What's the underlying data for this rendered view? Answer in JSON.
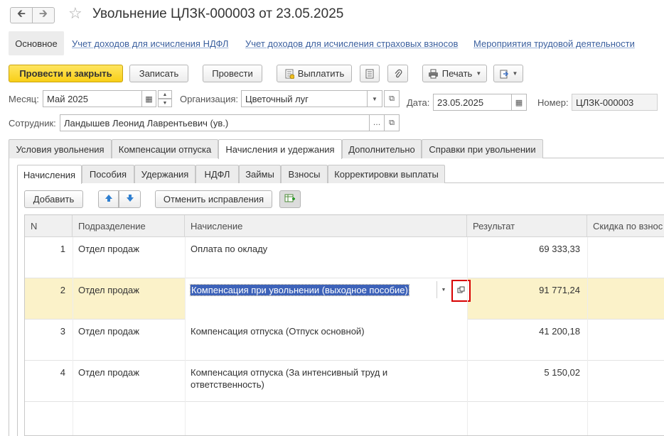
{
  "window": {
    "title": "Увольнение ЦЛЗК-000003 от 23.05.2025"
  },
  "section_tabs": {
    "main": "Основное",
    "links": [
      "Учет доходов для исчисления НДФЛ",
      "Учет доходов для исчисления страховых взносов",
      "Мероприятия трудовой деятельности"
    ]
  },
  "toolbar": {
    "post_close": "Провести и закрыть",
    "save": "Записать",
    "post": "Провести",
    "pay": "Выплатить",
    "print": "Печать"
  },
  "fields": {
    "month_label": "Месяц:",
    "month_value": "Май 2025",
    "org_label": "Организация:",
    "org_value": "Цветочный луг",
    "date_label": "Дата:",
    "date_value": "23.05.2025",
    "number_label": "Номер:",
    "number_value": "ЦЛЗК-000003",
    "employee_label": "Сотрудник:",
    "employee_value": "Ландышев Леонид Лаврентьевич (ув.)"
  },
  "tabs_main": [
    "Условия увольнения",
    "Компенсации отпуска",
    "Начисления и удержания",
    "Дополнительно",
    "Справки при увольнении"
  ],
  "tabs_sub": [
    "Начисления",
    "Пособия",
    "Удержания",
    "НДФЛ",
    "Займы",
    "Взносы",
    "Корректировки выплаты"
  ],
  "grid_toolbar": {
    "add": "Добавить",
    "cancel_fixes": "Отменить исправления"
  },
  "table": {
    "columns": [
      "N",
      "Подразделение",
      "Начисление",
      "Результат",
      "Скидка по взнос"
    ],
    "rows": [
      {
        "n": "1",
        "dept": "Отдел продаж",
        "accrual": "Оплата по окладу",
        "result": "69 333,33"
      },
      {
        "n": "2",
        "dept": "Отдел продаж",
        "accrual": "Компенсация при увольнении (выходное пособие)",
        "result": "91 771,24"
      },
      {
        "n": "3",
        "dept": "Отдел продаж",
        "accrual": "Компенсация отпуска (Отпуск основной)",
        "result": "41 200,18"
      },
      {
        "n": "4",
        "dept": "Отдел продаж",
        "accrual": "Компенсация отпуска (За интенсивный труд и ответственность)",
        "result": "5 150,02"
      }
    ]
  },
  "colors": {
    "primary_button": "#f8cf17",
    "selected_row": "#fbf2c9",
    "edit_highlight": "#3d62b9",
    "callout_box": "#d80000",
    "link": "#3a5f9e"
  },
  "icons": [
    "arrow-left-icon",
    "arrow-right-icon",
    "star-icon",
    "printer-icon",
    "paperclip-icon",
    "list-icon",
    "arrow-up-icon",
    "arrow-down-icon",
    "open-icon"
  ]
}
